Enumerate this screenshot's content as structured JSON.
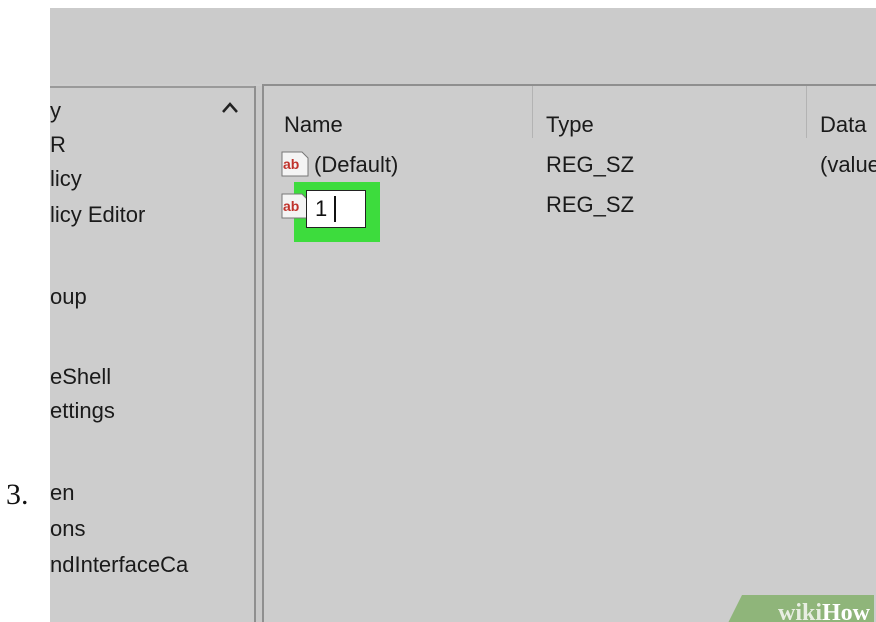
{
  "step": {
    "number": "3."
  },
  "tree": {
    "items": [
      {
        "label": "y"
      },
      {
        "label": "R"
      },
      {
        "label": "licy"
      },
      {
        "label": "licy Editor"
      },
      {
        "label": "oup"
      },
      {
        "label": "eShell"
      },
      {
        "label": "ettings"
      },
      {
        "label": "en"
      },
      {
        "label": "ons"
      },
      {
        "label": "ndInterfaceCa"
      }
    ]
  },
  "list": {
    "columns": {
      "name": "Name",
      "type": "Type",
      "data": "Data"
    },
    "rows": [
      {
        "name": "(Default)",
        "type": "REG_SZ",
        "data": "(value",
        "icon": "reg-string-icon"
      },
      {
        "name": "1",
        "type": "REG_SZ",
        "data": "",
        "icon": "reg-string-icon"
      }
    ],
    "rename_value": "1"
  },
  "watermark": {
    "brand_a": "wiki",
    "brand_b": "How"
  },
  "colors": {
    "highlight": "#3ddc3d",
    "window_bg": "#cdcdcd",
    "icon_red": "#c0322b"
  }
}
